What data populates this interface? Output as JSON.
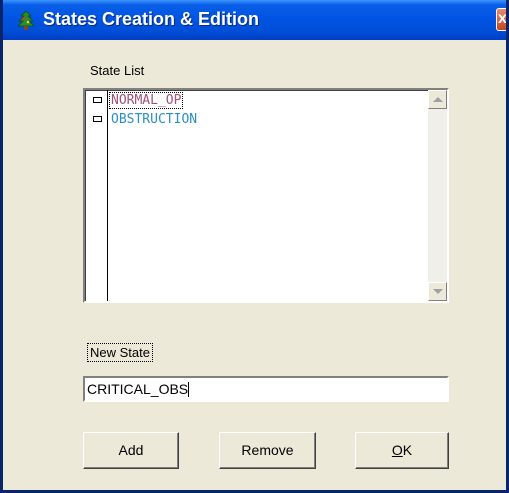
{
  "window": {
    "title": "States Creation & Edition",
    "icon": "tree-app-icon",
    "close_label": "x"
  },
  "state_list": {
    "label": "State List",
    "items": [
      {
        "label": "NORMAL_OP",
        "color": "#a0527a",
        "selected": true
      },
      {
        "label": "OBSTRUCTION",
        "color": "#2a8fc5",
        "selected": false
      }
    ]
  },
  "new_state": {
    "label": "New State",
    "value": "CRITICAL_OBS"
  },
  "buttons": {
    "add": "Add",
    "remove": "Remove",
    "ok": "OK"
  },
  "colors": {
    "titlebar": "#0054e3",
    "dialog_bg": "#ece9d8"
  }
}
